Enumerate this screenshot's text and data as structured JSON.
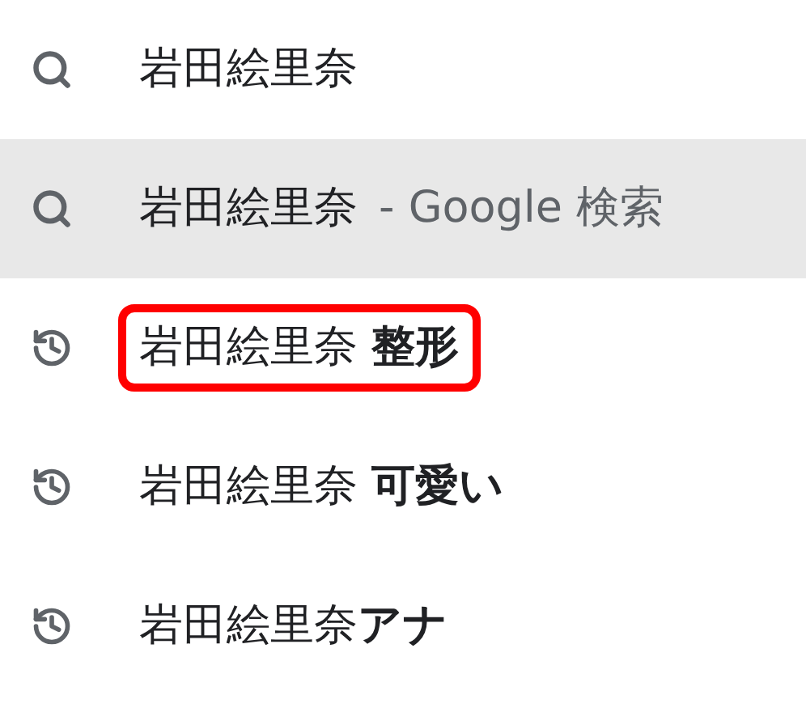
{
  "suggestions": [
    {
      "kind": "search",
      "text": "岩田絵里奈",
      "selected": false,
      "outlined": false
    },
    {
      "kind": "search",
      "text": "岩田絵里奈",
      "suffix": "- Google 検索",
      "selected": true,
      "outlined": false
    },
    {
      "kind": "history",
      "text": "岩田絵里奈 **整形**",
      "selected": false,
      "outlined": true
    },
    {
      "kind": "history",
      "text": "岩田絵里奈 **可愛い**",
      "selected": false,
      "outlined": false
    },
    {
      "kind": "history",
      "text": "岩田絵里奈**アナ**",
      "selected": false,
      "outlined": false
    }
  ]
}
